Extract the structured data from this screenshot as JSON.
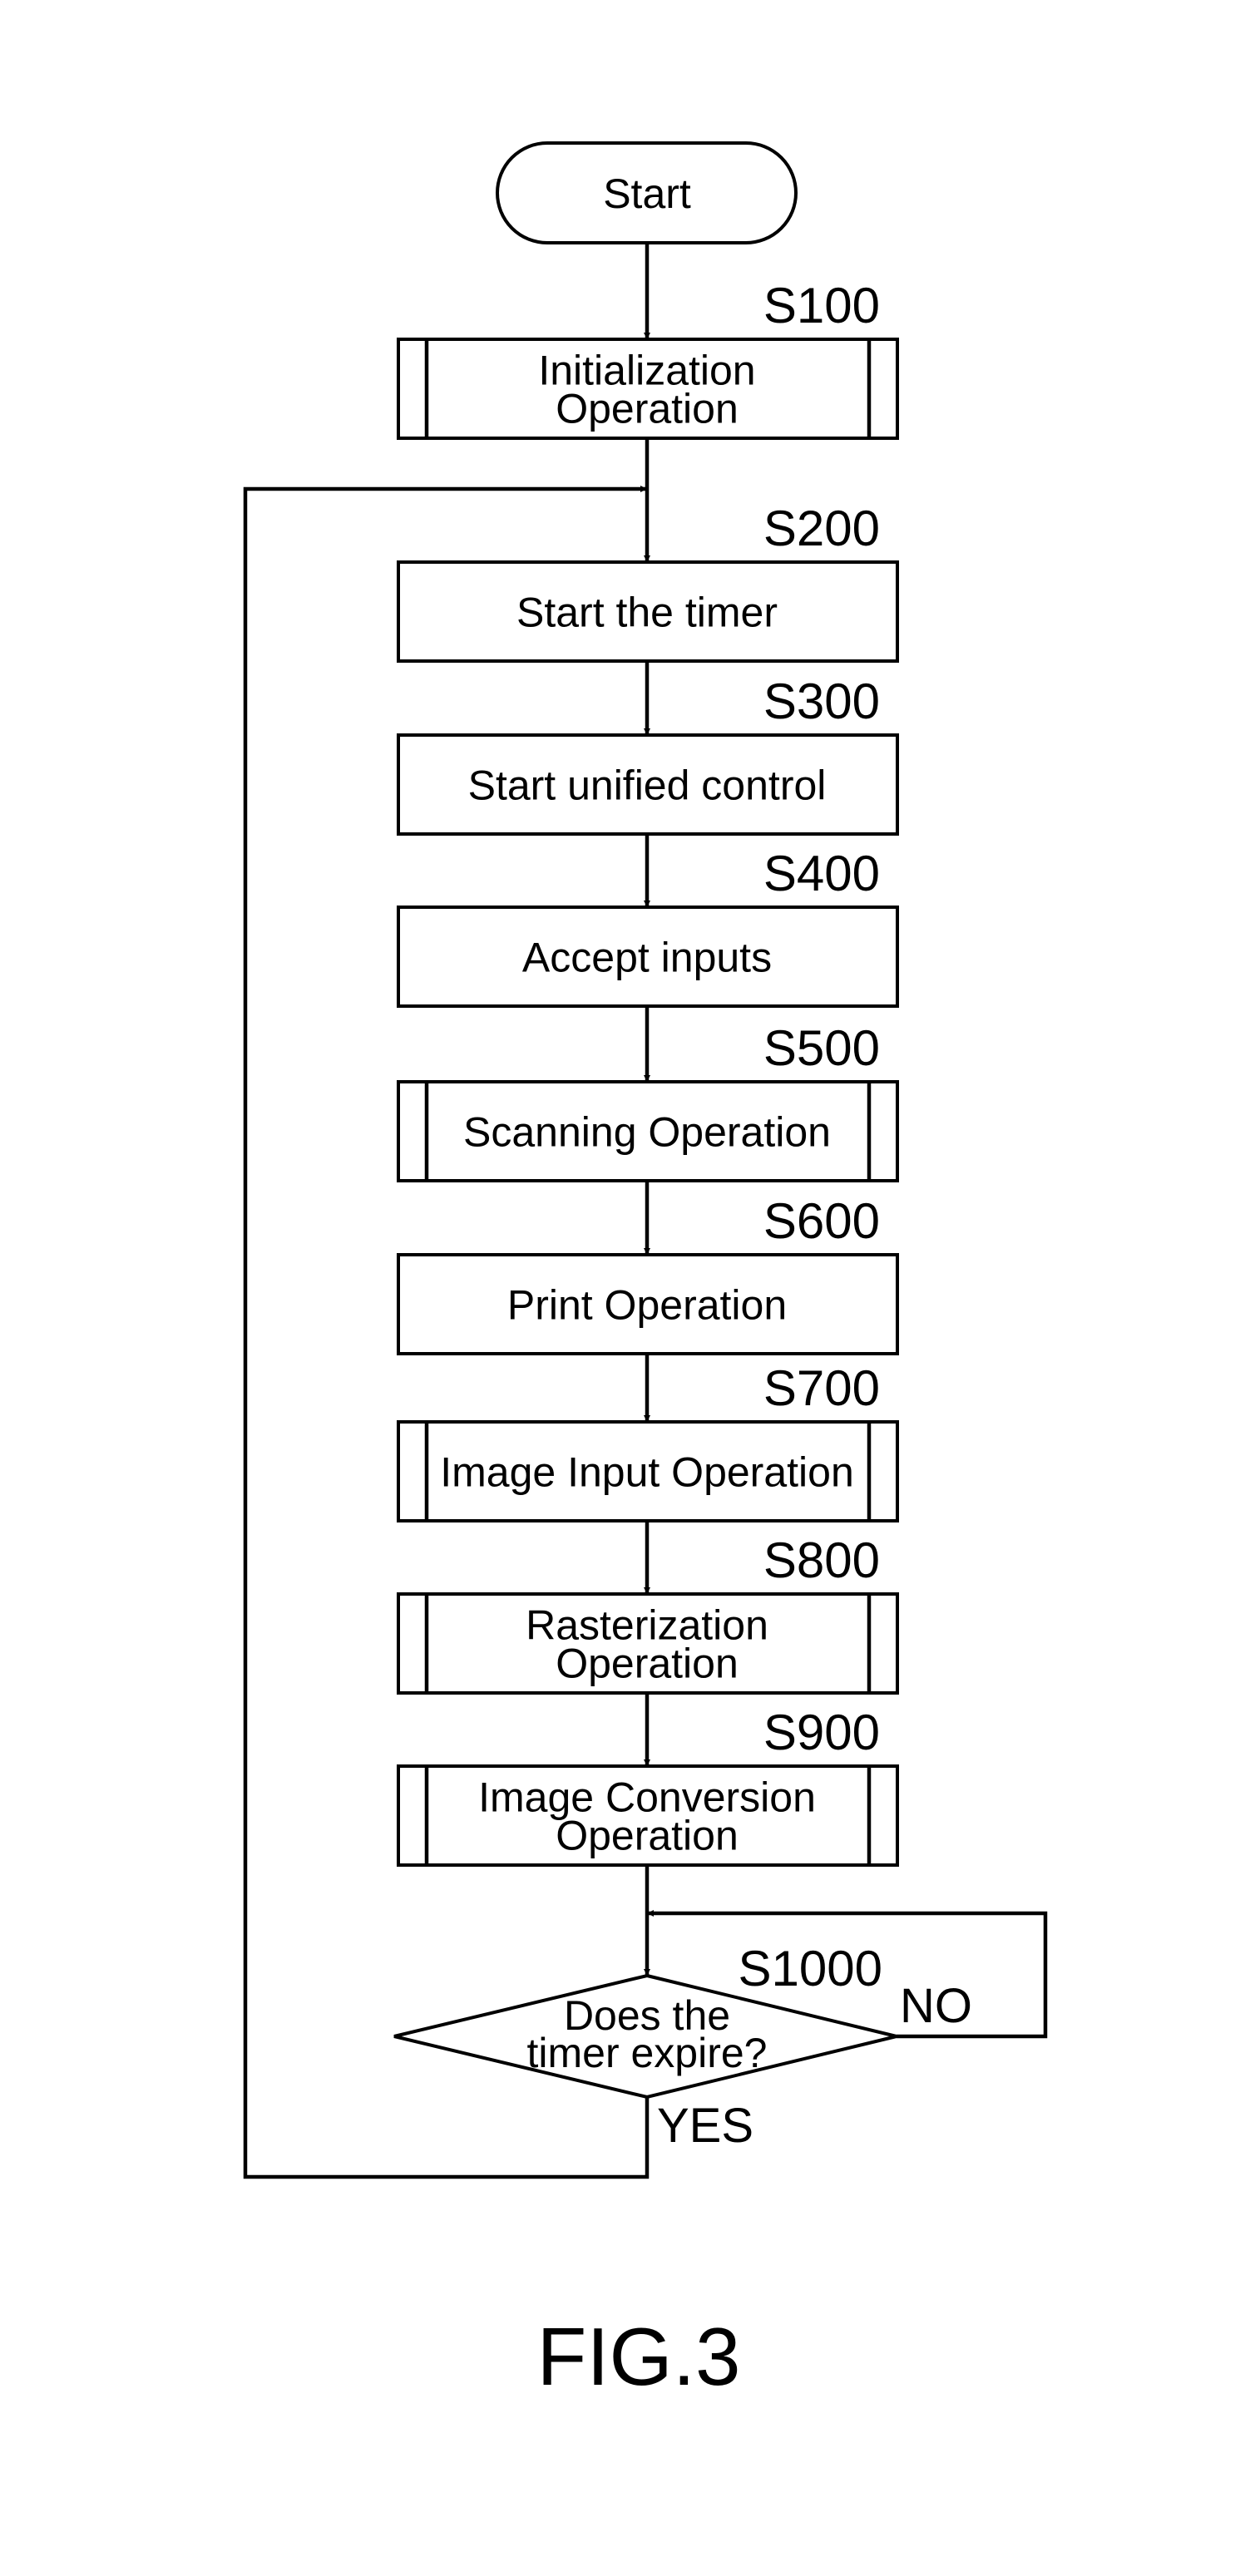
{
  "figure": {
    "caption": "FIG.3",
    "colors": {
      "ink": "#000000",
      "background": "#ffffff"
    }
  },
  "start": {
    "label": "Start"
  },
  "steps": [
    {
      "id": "S100",
      "type": "subprocess",
      "lines": [
        "Initialization",
        "Operation"
      ]
    },
    {
      "id": "S200",
      "type": "process",
      "lines": [
        "Start the timer"
      ]
    },
    {
      "id": "S300",
      "type": "process",
      "lines": [
        "Start unified control"
      ]
    },
    {
      "id": "S400",
      "type": "process",
      "lines": [
        "Accept inputs"
      ]
    },
    {
      "id": "S500",
      "type": "subprocess",
      "lines": [
        "Scanning Operation"
      ]
    },
    {
      "id": "S600",
      "type": "process",
      "lines": [
        "Print Operation"
      ]
    },
    {
      "id": "S700",
      "type": "subprocess",
      "lines": [
        "Image Input Operation"
      ]
    },
    {
      "id": "S800",
      "type": "subprocess",
      "lines": [
        "Rasterization",
        "Operation"
      ]
    },
    {
      "id": "S900",
      "type": "subprocess",
      "lines": [
        "Image Conversion",
        "Operation"
      ]
    }
  ],
  "decision": {
    "id": "S1000",
    "lines": [
      "Does the",
      "timer expire?"
    ],
    "yes_label": "YES",
    "no_label": "NO",
    "yes_target": "S200",
    "no_target": "S1000"
  }
}
